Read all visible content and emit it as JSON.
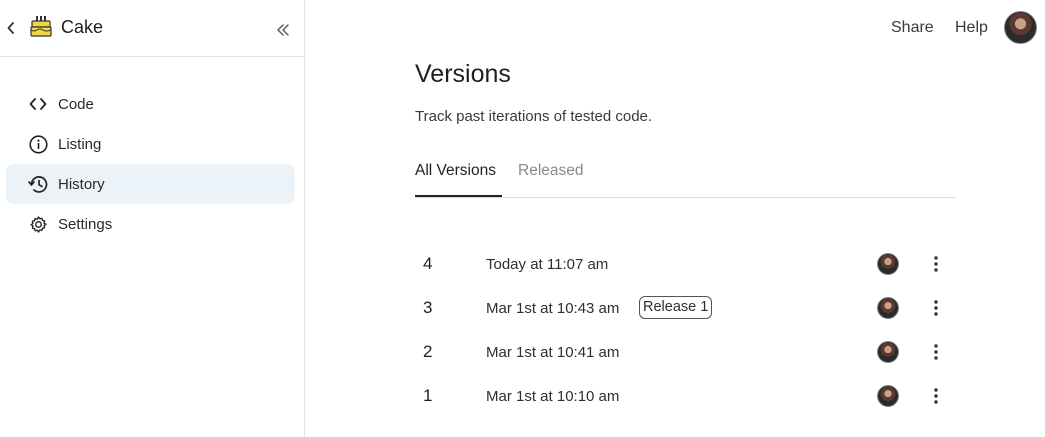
{
  "sidebar": {
    "app_name": "Cake",
    "items": [
      {
        "label": "Code",
        "icon": "code-icon"
      },
      {
        "label": "Listing",
        "icon": "info-icon"
      },
      {
        "label": "History",
        "icon": "history-icon",
        "active": true
      },
      {
        "label": "Settings",
        "icon": "gear-icon"
      }
    ]
  },
  "topbar": {
    "share_label": "Share",
    "help_label": "Help"
  },
  "main": {
    "title": "Versions",
    "subtitle": "Track past iterations of tested code.",
    "tabs": [
      {
        "label": "All Versions",
        "active": true
      },
      {
        "label": "Released",
        "active": false
      }
    ],
    "versions": [
      {
        "number": "4",
        "date": "Today at 11:07 am",
        "badge": ""
      },
      {
        "number": "3",
        "date": "Mar 1st at 10:43 am",
        "badge": "Release 1"
      },
      {
        "number": "2",
        "date": "Mar 1st at 10:41 am",
        "badge": ""
      },
      {
        "number": "1",
        "date": "Mar 1st at 10:10 am",
        "badge": ""
      }
    ]
  },
  "colors": {
    "active_nav_bg": "#ecf3f8",
    "border": "#e3e3e3",
    "tab_inactive": "#8a8a8a",
    "text": "#1f1f1f"
  }
}
